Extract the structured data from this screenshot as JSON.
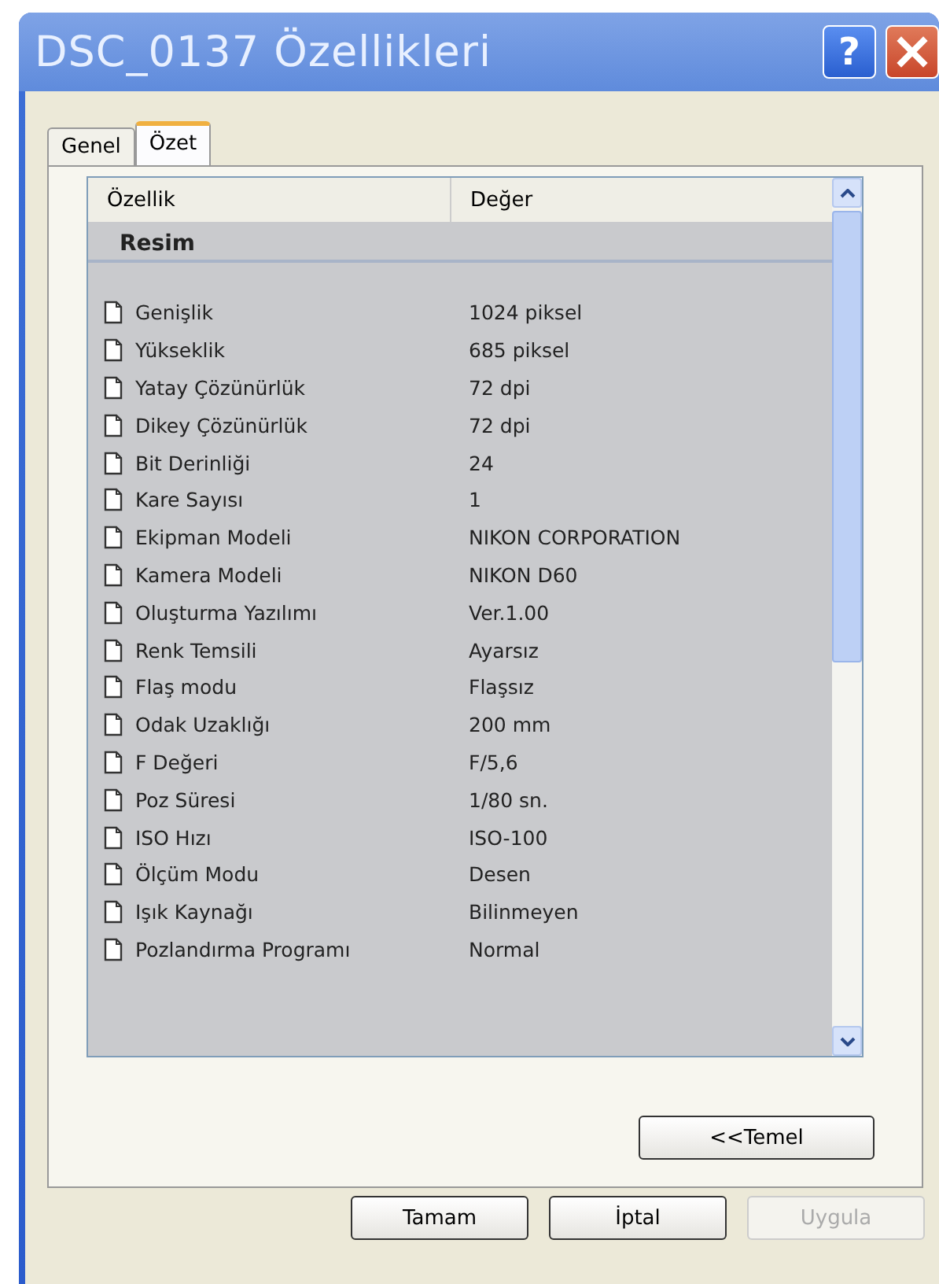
{
  "window": {
    "title": "DSC_0137 Özellikleri",
    "help_button": "?"
  },
  "tabs": [
    {
      "label": "Genel",
      "selected": false
    },
    {
      "label": "Özet",
      "selected": true
    }
  ],
  "table": {
    "columns": [
      "Özellik",
      "Değer"
    ],
    "groups": [
      {
        "title": "Resim",
        "rows": [
          {
            "property": "Genişlik",
            "value": "1024 piksel"
          },
          {
            "property": "Yükseklik",
            "value": "685 piksel"
          },
          {
            "property": "Yatay Çözünürlük",
            "value": "72 dpi"
          },
          {
            "property": "Dikey Çözünürlük",
            "value": "72 dpi"
          },
          {
            "property": "Bit Derinliği",
            "value": "24"
          },
          {
            "property": "Kare Sayısı",
            "value": "1"
          },
          {
            "property": "Ekipman Modeli",
            "value": "NIKON CORPORATION"
          },
          {
            "property": "Kamera Modeli",
            "value": "NIKON D60"
          },
          {
            "property": "Oluşturma Yazılımı",
            "value": "Ver.1.00"
          },
          {
            "property": "Renk Temsili",
            "value": "Ayarsız"
          },
          {
            "property": "Flaş modu",
            "value": "Flaşsız"
          },
          {
            "property": "Odak Uzaklığı",
            "value": "200 mm"
          },
          {
            "property": "F Değeri",
            "value": "F/5,6"
          },
          {
            "property": "Poz Süresi",
            "value": "1/80 sn."
          },
          {
            "property": "ISO Hızı",
            "value": "ISO-100"
          },
          {
            "property": "Ölçüm Modu",
            "value": "Desen"
          },
          {
            "property": "Işık Kaynağı",
            "value": "Bilinmeyen"
          },
          {
            "property": "Pozlandırma Programı",
            "value": "Normal"
          }
        ]
      }
    ]
  },
  "toggle_button": {
    "label": "<<Temel"
  },
  "buttons": [
    {
      "label": "Tamam",
      "disabled": false
    },
    {
      "label": "İptal",
      "disabled": false
    },
    {
      "label": "Uygula",
      "disabled": true
    }
  ]
}
